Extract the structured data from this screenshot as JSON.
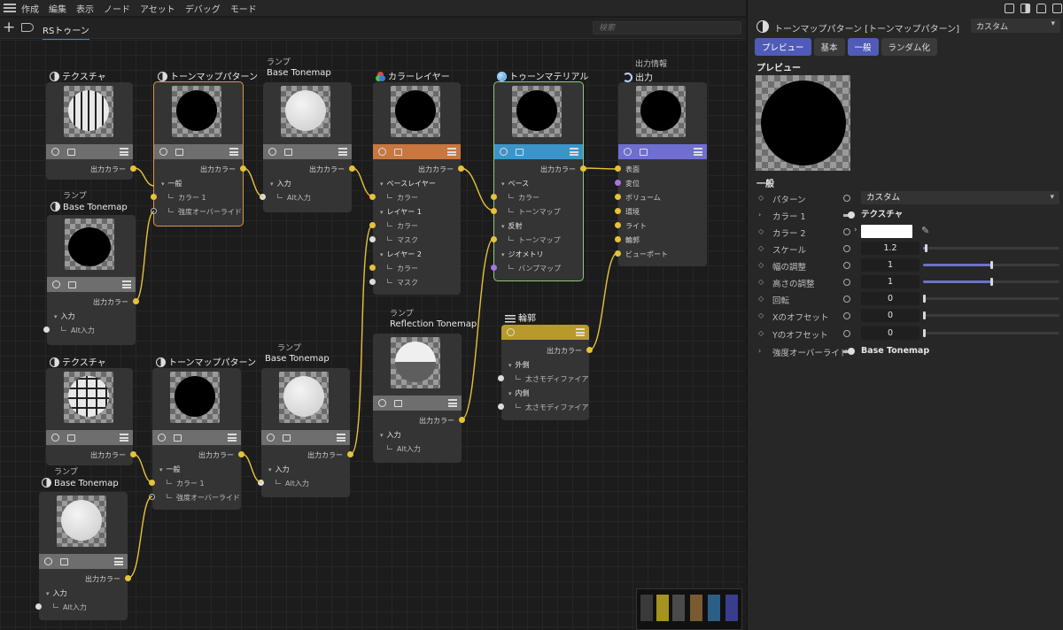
{
  "menu": [
    "作成",
    "編集",
    "表示",
    "ノード",
    "アセット",
    "デバッグ",
    "モード"
  ],
  "toolbar": {
    "tab_label": "RSトゥーン",
    "search_placeholder": "検索"
  },
  "nodes": {
    "tex1": {
      "title": "テクスチャ",
      "out": "出力カラー"
    },
    "tp1": {
      "title": "トーンマップパターン",
      "out": "出力カラー",
      "group": "一般",
      "in1": "カラー 1",
      "in2": "強度オーバーライド"
    },
    "ramp1": {
      "sub": "ランプ",
      "title": "Base Tonemap",
      "out": "出力カラー",
      "group": "入力",
      "in1": "Alt入力"
    },
    "ramp_left1": {
      "sub": "ランプ",
      "title": "Base Tonemap",
      "out": "出力カラー",
      "group": "入力",
      "in1": "Alt入力"
    },
    "layer": {
      "title": "カラーレイヤー",
      "out": "出力カラー",
      "g1": "ベースレイヤー",
      "g1a": "カラー",
      "g2": "レイヤー 1",
      "g2a": "カラー",
      "g2b": "マスク",
      "g3": "レイヤー 2",
      "g3a": "カラー",
      "g3b": "マスク"
    },
    "toonmat": {
      "title": "トゥーンマテリアル",
      "out": "出力カラー",
      "g1": "ベース",
      "g1a": "カラー",
      "g1b": "トーンマップ",
      "g2": "反射",
      "g2a": "トーンマップ",
      "g3": "ジオメトリ",
      "g3a": "バンプマップ"
    },
    "output": {
      "sub": "出力情報",
      "title": "出力",
      "ports": [
        "表面",
        "変位",
        "ボリューム",
        "環境",
        "ライト",
        "輪郭",
        "ビューポート"
      ]
    },
    "refl": {
      "sub": "ランプ",
      "title": "Reflection Tonemap",
      "out": "出力カラー",
      "group": "入力",
      "in1": "Alt入力"
    },
    "contour": {
      "title": "輪郭",
      "out": "出力カラー",
      "g1": "外側",
      "g1a": "太さモディファイア",
      "g2": "内側",
      "g2a": "太さモディファイア"
    },
    "tex2": {
      "title": "テクスチャ",
      "out": "出力カラー"
    },
    "tp2": {
      "title": "トーンマップパターン",
      "out": "出力カラー",
      "group": "一般",
      "in1": "カラー 1",
      "in2": "強度オーバーライド"
    },
    "ramp2": {
      "sub": "ランプ",
      "title": "Base Tonemap",
      "out": "出力カラー",
      "group": "入力",
      "in1": "Alt入力"
    },
    "ramp_left2": {
      "sub": "ランプ",
      "title": "Base Tonemap",
      "out": "出力カラー",
      "group": "入力",
      "in1": "Alt入力"
    }
  },
  "panel": {
    "title": "トーンマップパターン [トーンマップパターン]",
    "preset": "カスタム",
    "tabs": [
      "プレビュー",
      "基本",
      "一般",
      "ランダム化"
    ],
    "preview_heading": "プレビュー",
    "general_heading": "一般",
    "props": [
      {
        "label": "パターン",
        "value": "カスタム"
      },
      {
        "label": "カラー 1",
        "value": "テクスチャ"
      },
      {
        "label": "カラー 2",
        "value": ""
      },
      {
        "label": "スケール",
        "value": "1.2",
        "fraction": 0.02
      },
      {
        "label": "幅の調整",
        "value": "1",
        "fraction": 0.5
      },
      {
        "label": "高さの調整",
        "value": "1",
        "fraction": 0.5
      },
      {
        "label": "回転",
        "value": "0",
        "fraction": 0
      },
      {
        "label": "Xのオフセット",
        "value": "0",
        "fraction": 0
      },
      {
        "label": "Yのオフセット",
        "value": "0",
        "fraction": 0
      },
      {
        "label": "強度オーバーライド",
        "value": "Base Tonemap"
      }
    ]
  },
  "colors": {
    "accent_tab": "#4f5bb6",
    "orange_bar": "#c8773f",
    "blue_bar": "#3b95c9",
    "purple_bar": "#6f6fcf",
    "olive_bar": "#b89a2b",
    "port_yellow": "#e6c23a",
    "port_purple": "#a874e0"
  }
}
